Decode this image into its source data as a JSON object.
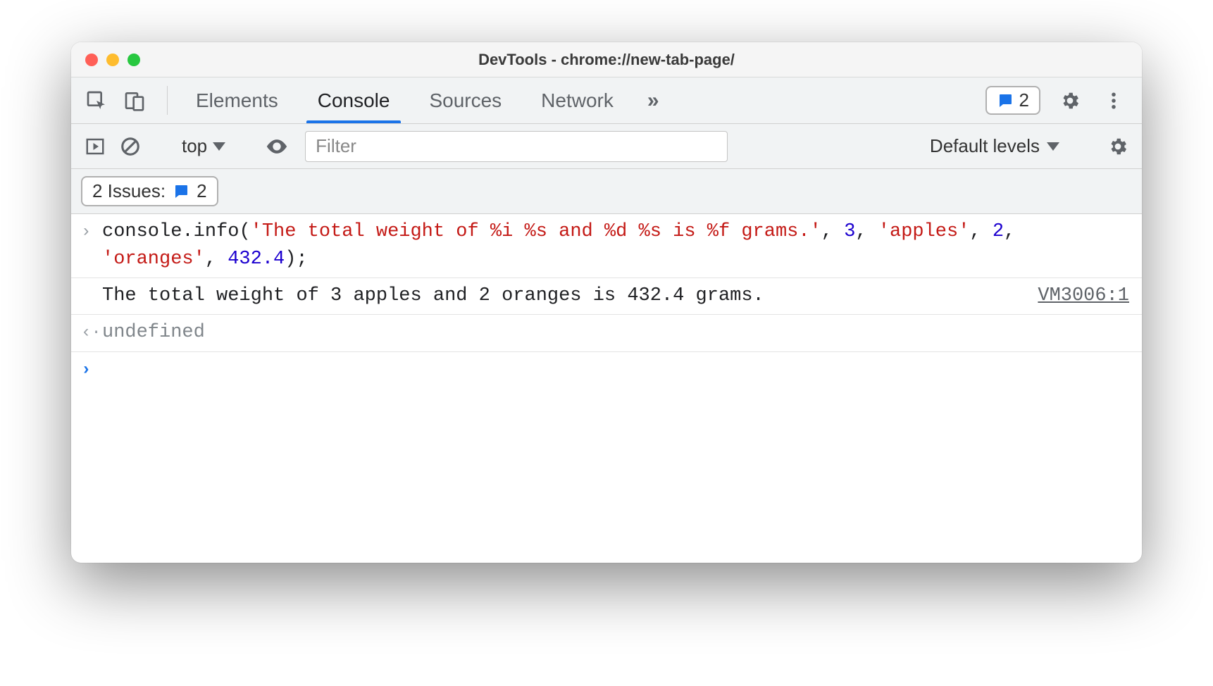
{
  "window": {
    "title": "DevTools - chrome://new-tab-page/"
  },
  "tabs": {
    "items": [
      "Elements",
      "Console",
      "Sources",
      "Network"
    ],
    "active": "Console",
    "more_glyph": "»",
    "issues_count": "2"
  },
  "toolbar": {
    "context": "top",
    "filter_placeholder": "Filter",
    "levels_label": "Default levels"
  },
  "issues_bar": {
    "label": "2 Issues:",
    "count": "2"
  },
  "console": {
    "command": {
      "tokens": [
        {
          "t": "obj",
          "v": "console"
        },
        {
          "t": "punc",
          "v": "."
        },
        {
          "t": "obj",
          "v": "info"
        },
        {
          "t": "punc",
          "v": "("
        },
        {
          "t": "str",
          "v": "'The total weight of %i %s and %d %s is %f grams.'"
        },
        {
          "t": "punc",
          "v": ", "
        },
        {
          "t": "num",
          "v": "3"
        },
        {
          "t": "punc",
          "v": ", "
        },
        {
          "t": "str",
          "v": "'apples'"
        },
        {
          "t": "punc",
          "v": ", "
        },
        {
          "t": "num",
          "v": "2"
        },
        {
          "t": "punc",
          "v": ", "
        },
        {
          "t": "str",
          "v": "'oranges'"
        },
        {
          "t": "punc",
          "v": ", "
        },
        {
          "t": "num",
          "v": "432.4"
        },
        {
          "t": "punc",
          "v": ");"
        }
      ]
    },
    "output": {
      "text": "The total weight of 3 apples and 2 oranges is 432.4 grams.",
      "source": "VM3006:1"
    },
    "return_value": "undefined"
  }
}
